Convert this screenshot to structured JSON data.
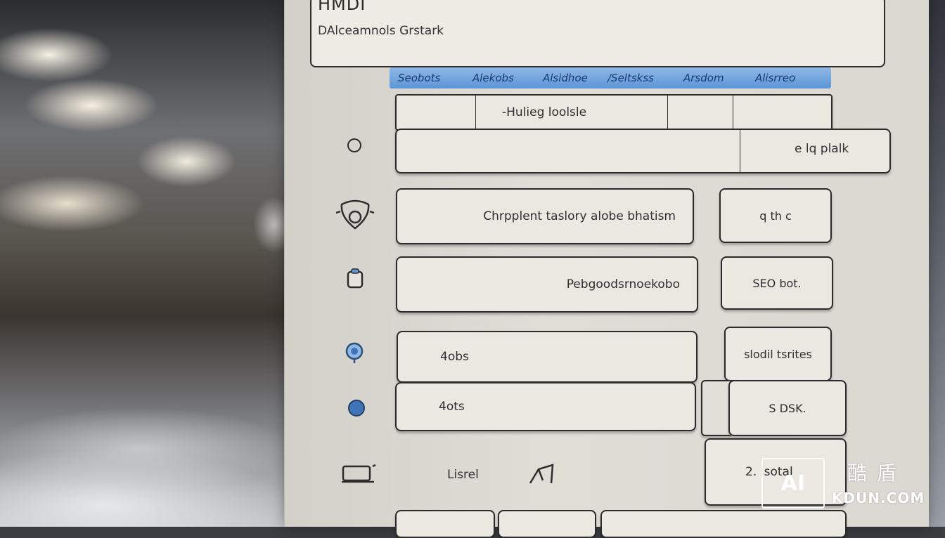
{
  "header": {
    "title": "HMDI",
    "subtitle": "DAlceamnols Grstark"
  },
  "tabs": [
    "Seobots",
    "Alekobs",
    "Alsidhoe",
    "/Seltskss",
    "Arsdom",
    "Alisrreo"
  ],
  "form_rows": [
    {
      "field_text": "-Hulieg loolsle",
      "side_text": ""
    },
    {
      "field_text": "",
      "side_text": "e lq plalk"
    },
    {
      "field_text": "Chrpplent taslory alobe bhatism",
      "side_text": "q th c"
    },
    {
      "field_text": "Pebgoodsrnoekobo",
      "side_text": "SEO  bot."
    },
    {
      "field_text": "4obs",
      "side_text": "slodil tsrites"
    },
    {
      "field_text": "4ots",
      "side_text": "S  DSK."
    }
  ],
  "footer": {
    "label": "Lisrel",
    "action": "2. Isotal"
  },
  "icons": [
    "radio-empty-icon",
    "shield-face-icon",
    "clipboard-icon",
    "location-pin-icon",
    "radio-filled-icon",
    "monitor-icon",
    "pen-icon"
  ],
  "watermark": {
    "badge": "AI",
    "cn": "酷盾",
    "en": "KDUN.COM"
  },
  "colors": {
    "accent": "#5c95d8",
    "panel": "#dcd9d3",
    "field": "#ebe8e2"
  }
}
